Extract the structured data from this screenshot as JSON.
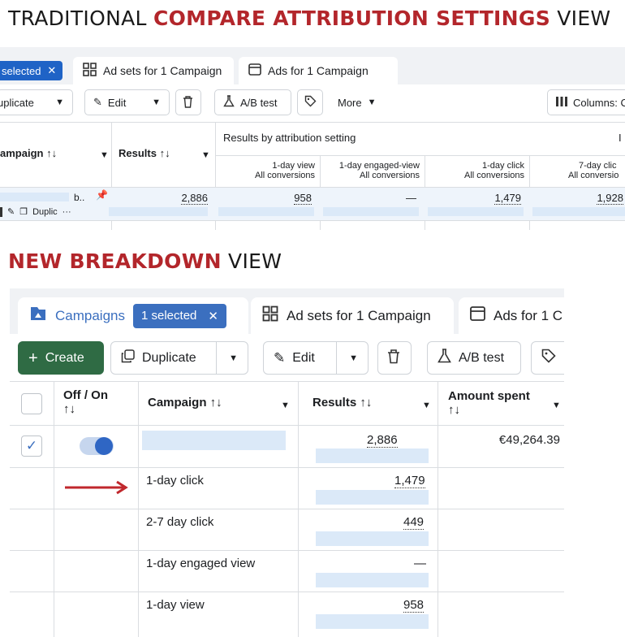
{
  "headings": {
    "traditional_prefix": "TRADITIONAL ",
    "traditional_highlight": "COMPARE ATTRIBUTION SETTINGS",
    "traditional_suffix": " VIEW",
    "new_highlight": "NEW BREAKDOWN",
    "new_suffix": " VIEW"
  },
  "old_view": {
    "tabs": {
      "selected": "selected",
      "ad_sets": "Ad sets for 1 Campaign",
      "ads": "Ads for 1 Campaign"
    },
    "toolbar": {
      "duplicate": "uplicate",
      "edit": "Edit",
      "ab_test": "A/B test",
      "more": "More",
      "columns": "Columns: C"
    },
    "columns": {
      "campaign": "ampaign ↑↓",
      "results": "Results ↑↓",
      "by_attribution": "Results by attribution setting",
      "truncated_right": "I"
    },
    "subcolumns": [
      {
        "line1": "1-day view",
        "line2": "All conversions"
      },
      {
        "line1": "1-day engaged-view",
        "line2": "All conversions"
      },
      {
        "line1": "1-day click",
        "line2": "All conversions"
      },
      {
        "line1": "7-day clic",
        "line2": "All conversio"
      }
    ],
    "row": {
      "name_fragment": "b..",
      "duplicate_fragment": "Duplic",
      "more_dots": "···",
      "results": "2,886",
      "values": [
        "958",
        "—",
        "1,479",
        "1,928"
      ]
    }
  },
  "new_view": {
    "tabs": {
      "campaigns": "Campaigns",
      "selected": "1 selected",
      "ad_sets": "Ad sets for 1 Campaign",
      "ads": "Ads for 1 C"
    },
    "toolbar": {
      "create": "Create",
      "duplicate": "Duplicate",
      "edit": "Edit",
      "ab_test": "A/B test"
    },
    "columns": {
      "off_on": "Off / On",
      "off_on_sort": "↑↓",
      "campaign": "Campaign ↑↓",
      "results": "Results ↑↓",
      "amount_spent": "Amount spent",
      "amount_sort": "↑↓"
    },
    "campaign_row": {
      "results": "2,886",
      "amount_spent": "€49,264.39"
    },
    "breakdown_rows": [
      {
        "label": "1-day click",
        "value": "1,479"
      },
      {
        "label": "2-7 day click",
        "value": "449"
      },
      {
        "label": "1-day engaged view",
        "value": "—"
      },
      {
        "label": "1-day view",
        "value": "958"
      }
    ]
  },
  "colors": {
    "accent_red": "#b3262b",
    "primary_blue": "#1f63c6",
    "create_green": "#2f6b44",
    "skeleton": "#dbe9f8"
  }
}
